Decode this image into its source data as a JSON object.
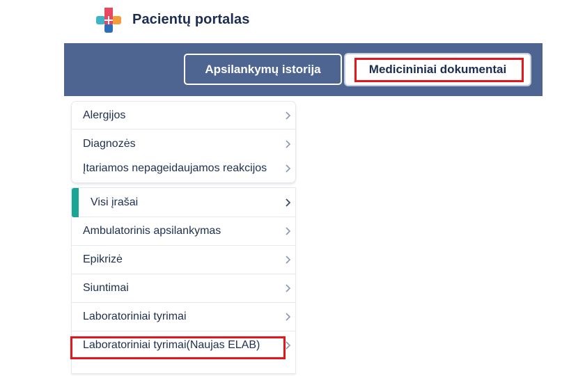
{
  "brand": {
    "title": "Pacientų portalas",
    "logo_icon": "medical-cross-logo",
    "logo_colors": [
      "#e8475f",
      "#f39c3a",
      "#3fb4c8",
      "#2a6fb7"
    ]
  },
  "nav": {
    "background": "#4d6590",
    "tabs": [
      {
        "label": "Apsilankymų istorija",
        "active": false
      },
      {
        "label": "Medicininiai dokumentai",
        "active": true
      }
    ]
  },
  "menu": {
    "group1": [
      {
        "label": "Alergijos",
        "icon": "chevron-right-icon"
      },
      {
        "label": "Diagnozės",
        "icon": "chevron-right-icon"
      },
      {
        "label": "Įtariamos nepageidaujamos reakcijos",
        "icon": "chevron-right-icon"
      }
    ],
    "group2": [
      {
        "label": "Visi įrašai",
        "active": true,
        "icon": "chevron-right-icon"
      },
      {
        "label": "Ambulatorinis apsilankymas",
        "icon": "chevron-right-icon"
      },
      {
        "label": "Epikrizė",
        "icon": "chevron-right-icon"
      },
      {
        "label": "Siuntimai",
        "icon": "chevron-right-icon"
      },
      {
        "label": "Laboratoriniai tyrimai",
        "icon": "chevron-right-icon"
      },
      {
        "label": "Laboratoriniai tyrimai(Naujas ELAB)",
        "icon": "chevron-right-icon"
      }
    ]
  },
  "colors": {
    "accent_active": "#1ba595",
    "highlight": "#e3161c",
    "text": "#1f2f4f"
  }
}
